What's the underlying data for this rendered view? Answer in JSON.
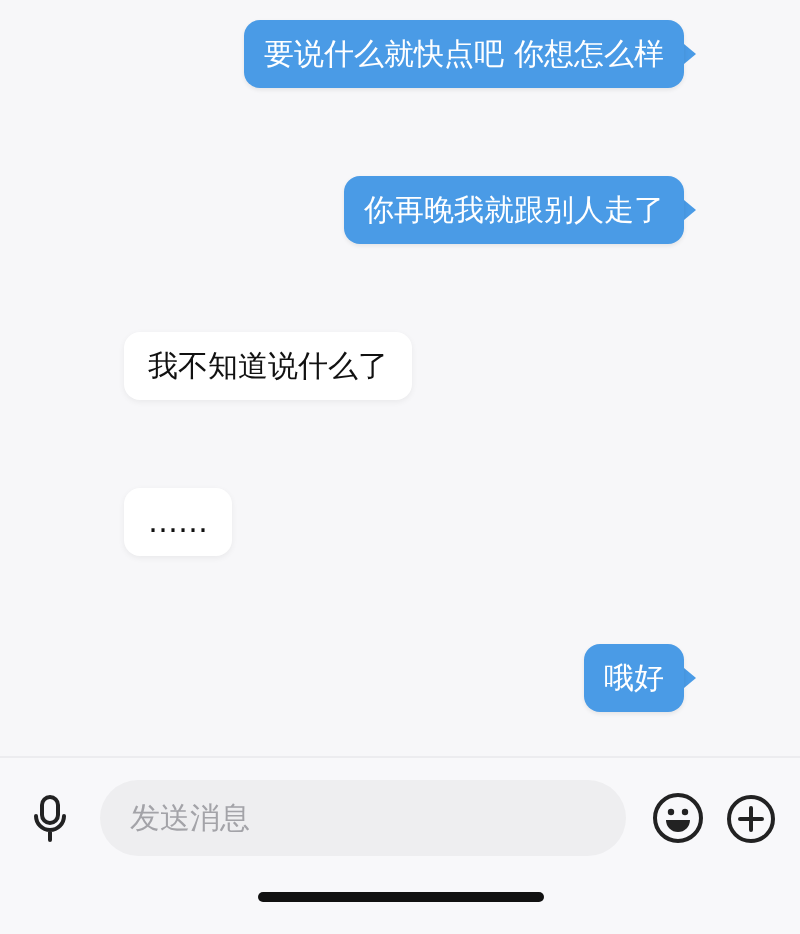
{
  "messages": [
    {
      "kind": "outgoing",
      "text": "要说什么就快点吧 你想怎么样"
    },
    {
      "kind": "outgoing",
      "text": "你再晚我就跟别人走了"
    },
    {
      "kind": "incoming",
      "text": "我不知道说什么了"
    },
    {
      "kind": "incoming",
      "text": "……"
    },
    {
      "kind": "outgoing",
      "text": "哦好"
    }
  ],
  "composer": {
    "placeholder": "发送消息"
  }
}
